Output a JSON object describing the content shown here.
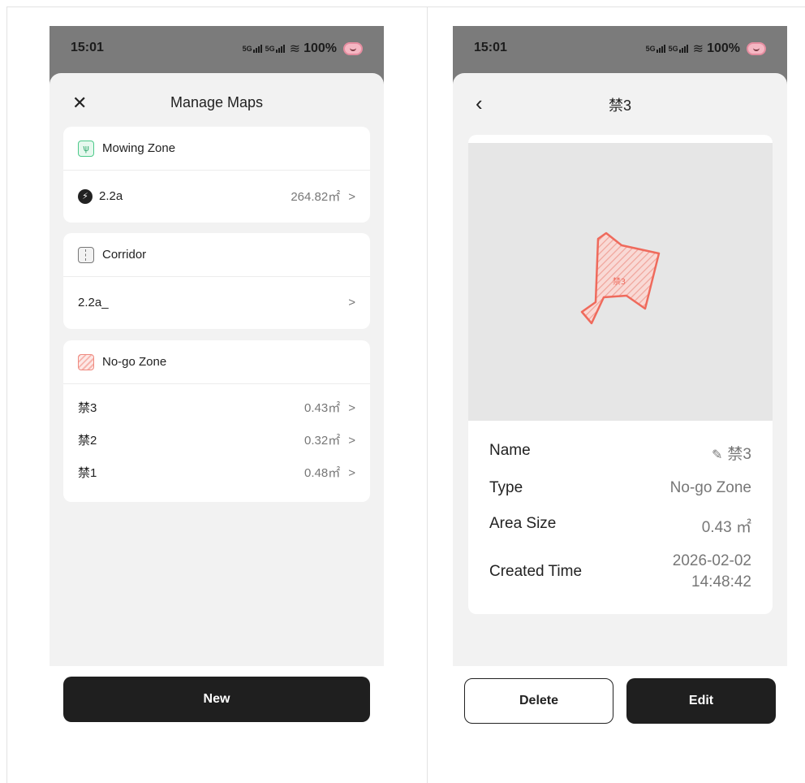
{
  "status": {
    "time": "15:01",
    "signal1": "5G",
    "signal2": "5G",
    "battery": "100%"
  },
  "left": {
    "title": "Manage Maps",
    "mowing": {
      "label": "Mowing Zone",
      "item": {
        "name": "2.2a",
        "area": "264.82㎡"
      }
    },
    "corridor": {
      "label": "Corridor",
      "item": {
        "name": "2.2a_"
      }
    },
    "nogo": {
      "label": "No-go Zone",
      "items": [
        {
          "name": "禁3",
          "area": "0.43㎡"
        },
        {
          "name": "禁2",
          "area": "0.32㎡"
        },
        {
          "name": "禁1",
          "area": "0.48㎡"
        }
      ]
    },
    "new_label": "New"
  },
  "right": {
    "title": "禁3",
    "map_label": "禁3",
    "fields": {
      "name_label": "Name",
      "name_value": "禁3",
      "type_label": "Type",
      "type_value": "No-go Zone",
      "area_label": "Area Size",
      "area_value": "0.43 ㎡",
      "created_label": "Created Time",
      "created_date": "2026-02-02",
      "created_time": "14:48:42"
    },
    "delete_label": "Delete",
    "edit_label": "Edit"
  },
  "colors": {
    "nogo": "#ef6a5c",
    "primary_button": "#1f1f1f",
    "mowing": "#4cc98a"
  }
}
